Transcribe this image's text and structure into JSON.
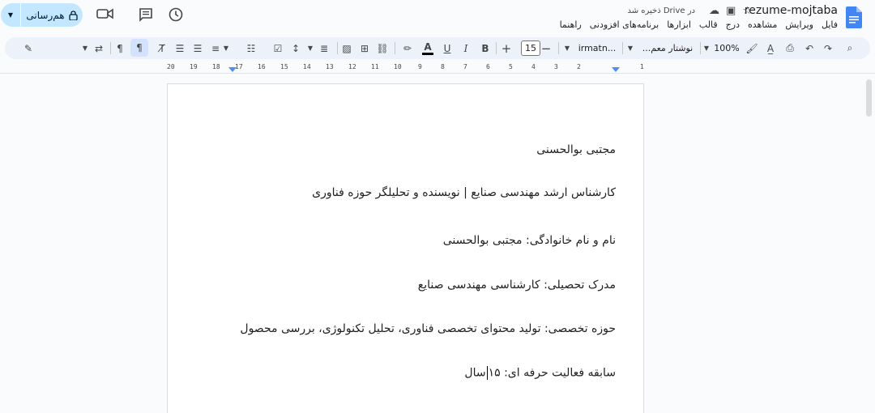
{
  "titlebar": {
    "doc_title": "rezume-mojtaba",
    "saved_status": "در Drive ذخیره شد",
    "share_label": "هم‌رسانی"
  },
  "menu": [
    "فایل",
    "ویرایش",
    "مشاهده",
    "درج",
    "قالب",
    "ابزارها",
    "برنامه‌های افزودنی",
    "راهنما"
  ],
  "toolbar": {
    "zoom": "100%",
    "style_dropdown": "نوشتار معم...",
    "font_dropdown": "irmatn...",
    "font_size": "15"
  },
  "ruler": {
    "labels": [
      "20",
      "19",
      "18",
      "17",
      "16",
      "15",
      "14",
      "13",
      "12",
      "11",
      "10",
      "9",
      "8",
      "7",
      "6",
      "5",
      "4",
      "3",
      "2",
      "1"
    ]
  },
  "document": {
    "lines": [
      "مجتبی بوالحسنی",
      "کارشناس ارشد مهندسی صنایع | نویسنده و تحلیلگر حوزه فناوری",
      "نام و نام خانوادگی: مجتبی بوالحسنی",
      "مدرک تحصیلی: کارشناسی مهندسی صنایع",
      "حوزه تخصصی: تولید محتوای تخصصی فناوری، تحلیل تکنولوژی، بررسی محصول"
    ],
    "experience_before": "سابقه فعالیت حرفه ای: ۱۵",
    "experience_after": "سال"
  },
  "icons": {
    "docs_logo": "google-docs-icon",
    "accent_blue": "#4285f4",
    "share_bg": "#c2e7ff"
  }
}
